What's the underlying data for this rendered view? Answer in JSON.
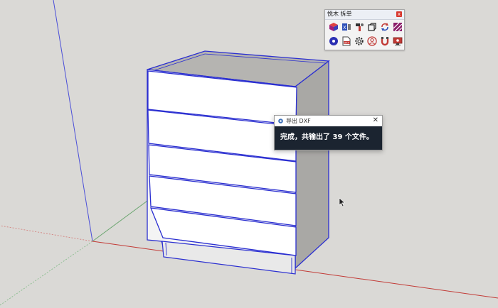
{
  "toolbar": {
    "title": "悦木 拆单",
    "close_label": "x",
    "row1_icons": [
      "cube-icon",
      "export-cut-icon",
      "plug-icon",
      "copy-box-icon",
      "refresh-icon",
      "hatch-icon"
    ],
    "row2_icons": [
      "disc-icon",
      "dxf-file-icon",
      "gear-icon",
      "user-circle-icon",
      "magnet-icon",
      "monitor-icon"
    ]
  },
  "dialog": {
    "title": "导出 DXF",
    "close_label": "✕",
    "message": "完成，共输出了 39 个文件。"
  },
  "colors": {
    "background": "#dad9d6",
    "edge": "#2b2fd1",
    "panel_front": "#ffffff",
    "panel_side": "#a9a8a5",
    "panel_top": "#b5b4b1",
    "dialog_body": "#1b2430",
    "red_axis": "#c23a36",
    "green_axis": "#5c9f63",
    "blue_axis": "#4b4fd8"
  }
}
